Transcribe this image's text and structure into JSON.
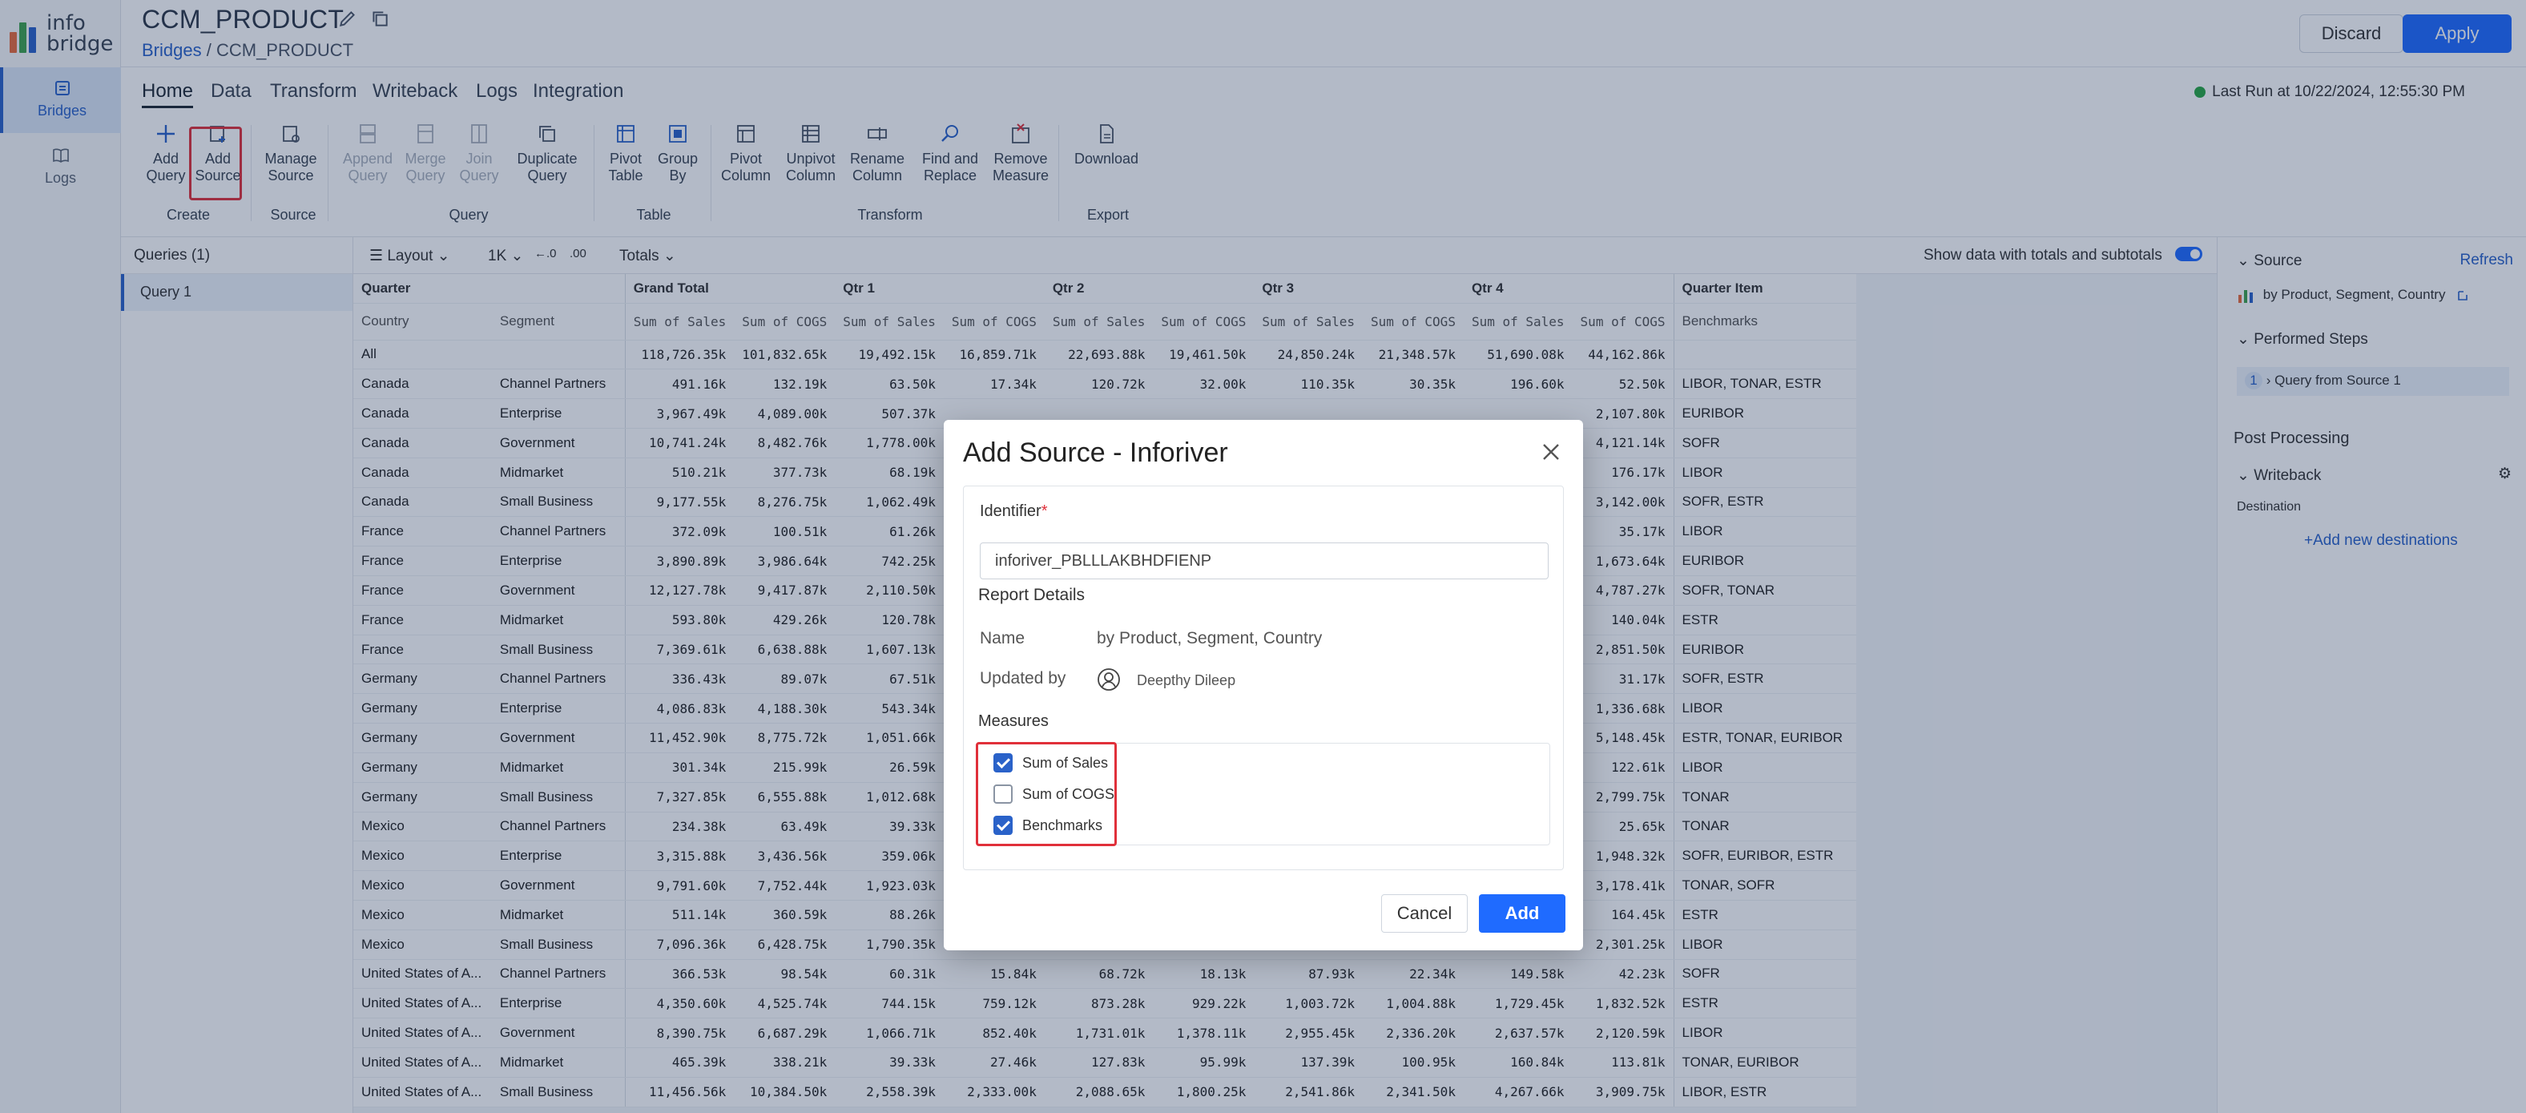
{
  "app": {
    "logo_text_top": "info",
    "logo_text_bottom": "bridge"
  },
  "leftnav": [
    {
      "label": "Bridges",
      "icon": "bridge-icon",
      "active": true
    },
    {
      "label": "Logs",
      "icon": "book-icon",
      "active": false
    }
  ],
  "header": {
    "title": "CCM_PRODUCT",
    "breadcrumb_root": "Bridges",
    "breadcrumb_sep": "/",
    "breadcrumb_current": "CCM_PRODUCT",
    "discard": "Discard",
    "apply": "Apply"
  },
  "tabs": [
    "Home",
    "Data",
    "Transform",
    "Writeback",
    "Logs",
    "Integration"
  ],
  "last_run": "Last Run at 10/22/2024, 12:55:30 PM",
  "ribbon": {
    "add_query": [
      "Add",
      "Query"
    ],
    "add_source": [
      "Add",
      "Source"
    ],
    "manage_source": [
      "Manage",
      "Source"
    ],
    "append_query": [
      "Append",
      "Query"
    ],
    "merge_query": [
      "Merge",
      "Query"
    ],
    "join_query": [
      "Join",
      "Query"
    ],
    "duplicate_query": [
      "Duplicate",
      "Query"
    ],
    "pivot_table": [
      "Pivot",
      "Table"
    ],
    "group_by": [
      "Group",
      "By"
    ],
    "pivot_column": [
      "Pivot",
      "Column"
    ],
    "unpivot_column": [
      "Unpivot",
      "Column"
    ],
    "rename_column": [
      "Rename",
      "Column"
    ],
    "find_replace": [
      "Find and",
      "Replace"
    ],
    "remove_measure": [
      "Remove",
      "Measure"
    ],
    "download": "Download",
    "groups": {
      "create": "Create",
      "source": "Source",
      "query": "Query",
      "table": "Table",
      "transform": "Transform",
      "export": "Export"
    }
  },
  "queries": {
    "header": "Queries",
    "count": "(1)",
    "items": [
      "Query 1"
    ]
  },
  "grid_toolbar": {
    "layout": "Layout",
    "rows": "1K",
    "totals": "Totals",
    "show_totals": "Show data with totals and subtotals"
  },
  "grid": {
    "top_headers": [
      "Quarter",
      "Grand Total",
      "Qtr 1",
      "Qtr 2",
      "Qtr 3",
      "Qtr 4",
      "Quarter Item"
    ],
    "sub_headers": [
      "Country",
      "Segment",
      "Sum of Sales",
      "Sum of COGS",
      "Sum of Sales",
      "Sum of COGS",
      "Sum of Sales",
      "Sum of COGS",
      "Sum of Sales",
      "Sum of COGS",
      "Sum of Sales",
      "Sum of COGS",
      "Benchmarks"
    ],
    "rows": [
      [
        "All",
        "",
        "118,726.35k",
        "101,832.65k",
        "19,492.15k",
        "16,859.71k",
        "22,693.88k",
        "19,461.50k",
        "24,850.24k",
        "21,348.57k",
        "51,690.08k",
        "44,162.86k",
        ""
      ],
      [
        "Canada",
        "Channel Partners",
        "491.16k",
        "132.19k",
        "63.50k",
        "17.34k",
        "120.72k",
        "32.00k",
        "110.35k",
        "30.35k",
        "196.60k",
        "52.50k",
        "LIBOR, TONAR, ESTR"
      ],
      [
        "Canada",
        "Enterprise",
        "3,967.49k",
        "4,089.00k",
        "507.37k",
        "",
        "",
        "",
        "",
        "",
        "",
        "2,107.80k",
        "EURIBOR"
      ],
      [
        "Canada",
        "Government",
        "10,741.24k",
        "8,482.76k",
        "1,778.00k",
        "",
        "",
        "",
        "",
        "",
        "",
        "4,121.14k",
        "SOFR"
      ],
      [
        "Canada",
        "Midmarket",
        "510.21k",
        "377.73k",
        "68.19k",
        "",
        "",
        "",
        "",
        "",
        "",
        "176.17k",
        "LIBOR"
      ],
      [
        "Canada",
        "Small Business",
        "9,177.55k",
        "8,276.75k",
        "1,062.49k",
        "",
        "",
        "",
        "",
        "",
        "",
        "3,142.00k",
        "SOFR, ESTR"
      ],
      [
        "France",
        "Channel Partners",
        "372.09k",
        "100.51k",
        "61.26k",
        "",
        "",
        "",
        "",
        "",
        "",
        "35.17k",
        "LIBOR"
      ],
      [
        "France",
        "Enterprise",
        "3,890.89k",
        "3,986.64k",
        "742.25k",
        "",
        "",
        "",
        "",
        "",
        "",
        "1,673.64k",
        "EURIBOR"
      ],
      [
        "France",
        "Government",
        "12,127.78k",
        "9,417.87k",
        "2,110.50k",
        "",
        "",
        "",
        "",
        "",
        "",
        "4,787.27k",
        "SOFR, TONAR"
      ],
      [
        "France",
        "Midmarket",
        "593.80k",
        "429.26k",
        "120.78k",
        "",
        "",
        "",
        "",
        "",
        "",
        "140.04k",
        "ESTR"
      ],
      [
        "France",
        "Small Business",
        "7,369.61k",
        "6,638.88k",
        "1,607.13k",
        "",
        "",
        "",
        "",
        "",
        "",
        "2,851.50k",
        "EURIBOR"
      ],
      [
        "Germany",
        "Channel Partners",
        "336.43k",
        "89.07k",
        "67.51k",
        "",
        "",
        "",
        "",
        "",
        "",
        "31.17k",
        "SOFR, ESTR"
      ],
      [
        "Germany",
        "Enterprise",
        "4,086.83k",
        "4,188.30k",
        "543.34k",
        "",
        "",
        "",
        "",
        "",
        "",
        "1,336.68k",
        "LIBOR"
      ],
      [
        "Germany",
        "Government",
        "11,452.90k",
        "8,775.72k",
        "1,051.66k",
        "",
        "",
        "",
        "",
        "",
        "",
        "5,148.45k",
        "ESTR, TONAR, EURIBOR"
      ],
      [
        "Germany",
        "Midmarket",
        "301.34k",
        "215.99k",
        "26.59k",
        "",
        "",
        "",
        "",
        "",
        "",
        "122.61k",
        "LIBOR"
      ],
      [
        "Germany",
        "Small Business",
        "7,327.85k",
        "6,555.88k",
        "1,012.68k",
        "",
        "",
        "",
        "",
        "",
        "",
        "2,799.75k",
        "TONAR"
      ],
      [
        "Mexico",
        "Channel Partners",
        "234.38k",
        "63.49k",
        "39.33k",
        "",
        "",
        "",
        "",
        "",
        "",
        "25.65k",
        "TONAR"
      ],
      [
        "Mexico",
        "Enterprise",
        "3,315.88k",
        "3,436.56k",
        "359.06k",
        "",
        "",
        "",
        "",
        "",
        "",
        "1,948.32k",
        "SOFR, EURIBOR, ESTR"
      ],
      [
        "Mexico",
        "Government",
        "9,791.60k",
        "7,752.44k",
        "1,923.03k",
        "",
        "",
        "",
        "",
        "",
        "",
        "3,178.41k",
        "TONAR, SOFR"
      ],
      [
        "Mexico",
        "Midmarket",
        "511.14k",
        "360.59k",
        "88.26k",
        "",
        "",
        "",
        "",
        "",
        "",
        "164.45k",
        "ESTR"
      ],
      [
        "Mexico",
        "Small Business",
        "7,096.36k",
        "6,428.75k",
        "1,790.35k",
        "",
        "",
        "",
        "",
        "",
        "",
        "2,301.25k",
        "LIBOR"
      ],
      [
        "United States of A...",
        "Channel Partners",
        "366.53k",
        "98.54k",
        "60.31k",
        "15.84k",
        "68.72k",
        "18.13k",
        "87.93k",
        "22.34k",
        "149.58k",
        "42.23k",
        "SOFR"
      ],
      [
        "United States of A...",
        "Enterprise",
        "4,350.60k",
        "4,525.74k",
        "744.15k",
        "759.12k",
        "873.28k",
        "929.22k",
        "1,003.72k",
        "1,004.88k",
        "1,729.45k",
        "1,832.52k",
        "ESTR"
      ],
      [
        "United States of A...",
        "Government",
        "8,390.75k",
        "6,687.29k",
        "1,066.71k",
        "852.40k",
        "1,731.01k",
        "1,378.11k",
        "2,955.45k",
        "2,336.20k",
        "2,637.57k",
        "2,120.59k",
        "LIBOR"
      ],
      [
        "United States of A...",
        "Midmarket",
        "465.39k",
        "338.21k",
        "39.33k",
        "27.46k",
        "127.83k",
        "95.99k",
        "137.39k",
        "100.95k",
        "160.84k",
        "113.81k",
        "TONAR, EURIBOR"
      ],
      [
        "United States of A...",
        "Small Business",
        "11,456.56k",
        "10,384.50k",
        "2,558.39k",
        "2,333.00k",
        "2,088.65k",
        "1,800.25k",
        "2,541.86k",
        "2,341.50k",
        "4,267.66k",
        "3,909.75k",
        "LIBOR, ESTR"
      ]
    ]
  },
  "right_panel": {
    "source": "Source",
    "refresh": "Refresh",
    "source_name": "by Product, Segment, Country",
    "performed_steps": "Performed Steps",
    "step_num": "1",
    "step": "Query from Source 1",
    "post_processing": "Post Processing",
    "writeback": "Writeback",
    "destination": "Destination",
    "add_dest": "+Add new destinations"
  },
  "modal": {
    "title": "Add Source - Inforiver",
    "identifier_label": "Identifier",
    "identifier_required": "*",
    "identifier_value": "inforiver_PBLLLAKBHDFIENP",
    "report_details": "Report Details",
    "name_label": "Name",
    "name_value": "by Product, Segment, Country",
    "updated_label": "Updated by",
    "updated_value": "Deepthy Dileep",
    "measures_label": "Measures",
    "measures": [
      {
        "label": "Sum of Sales",
        "checked": true
      },
      {
        "label": "Sum of COGS",
        "checked": false
      },
      {
        "label": "Benchmarks",
        "checked": true
      }
    ],
    "cancel": "Cancel",
    "add": "Add"
  },
  "colors": {
    "accent": "#1f6bff",
    "highlight": "#e0303a",
    "success": "#28a745"
  }
}
